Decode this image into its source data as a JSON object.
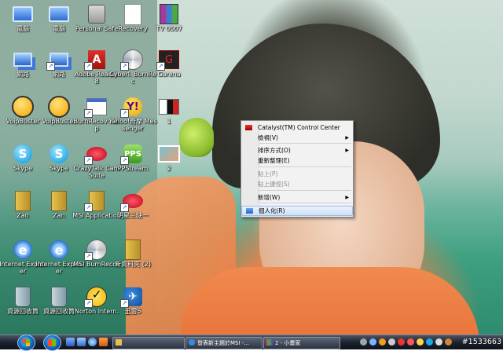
{
  "desktop": {
    "icons": [
      {
        "id": "pc1",
        "label": "電腦",
        "glyph": "computer-icon",
        "shortcut": false
      },
      {
        "id": "pc2",
        "label": "電腦",
        "glyph": "computer-icon",
        "shortcut": false
      },
      {
        "id": "lock",
        "label": "Personal Safe",
        "glyph": "lock-icon",
        "shortcut": false
      },
      {
        "id": "recovery",
        "label": "Recovery",
        "glyph": "document-icon",
        "shortcut": false
      },
      {
        "id": "tv",
        "label": "TV 0507",
        "glyph": "rar-archive-icon",
        "shortcut": false
      },
      {
        "id": "net1",
        "label": "網路",
        "glyph": "network-icon",
        "shortcut": false
      },
      {
        "id": "net2",
        "label": "網路",
        "glyph": "network-icon",
        "shortcut": true
      },
      {
        "id": "adobe",
        "label": "Adobe Reader 8",
        "glyph": "adobe-reader-icon",
        "shortcut": true
      },
      {
        "id": "cyberlink",
        "label": "Cyberl. BurnRec",
        "glyph": "disc-icon",
        "shortcut": true
      },
      {
        "id": "garena",
        "label": "Garena",
        "glyph": "garena-icon",
        "shortcut": true
      },
      {
        "id": "voip1",
        "label": "VoipBuster",
        "glyph": "voipbuster-icon",
        "shortcut": false
      },
      {
        "id": "voip2",
        "label": "VoipBuster",
        "glyph": "voipbuster-icon",
        "shortcut": false
      },
      {
        "id": "burnhelp",
        "label": "BurnRecov Help",
        "glyph": "window-icon",
        "shortcut": true
      },
      {
        "id": "yahoo",
        "label": "Yahoo!奇摩 Messenger",
        "glyph": "yahoo-messenger-icon",
        "shortcut": true
      },
      {
        "id": "img1",
        "label": "1",
        "glyph": "image-icon",
        "shortcut": false
      },
      {
        "id": "skype1",
        "label": "Skype",
        "glyph": "skype-icon",
        "shortcut": false
      },
      {
        "id": "skype2",
        "label": "Skype",
        "glyph": "skype-icon",
        "shortcut": false
      },
      {
        "id": "crazy",
        "label": "CrazyTalk Cam Suite",
        "glyph": "lips-icon",
        "shortcut": true
      },
      {
        "id": "pps",
        "label": "PPStream",
        "glyph": "pps-icon",
        "shortcut": true
      },
      {
        "id": "img2",
        "label": "2",
        "glyph": "photo-icon",
        "shortcut": false
      },
      {
        "id": "zan1",
        "label": "Zan",
        "glyph": "folder-zip-icon",
        "shortcut": false
      },
      {
        "id": "zan2",
        "label": "Zan",
        "glyph": "folder-zip-icon",
        "shortcut": false
      },
      {
        "id": "msi",
        "label": "MSI Application",
        "glyph": "folder-zip-icon",
        "shortcut": true
      },
      {
        "id": "game",
        "label": "明星三缺一",
        "glyph": "game-icon",
        "shortcut": true
      },
      {
        "id": "ie1",
        "label": "Internet Explorer",
        "glyph": "internet-explorer-icon",
        "shortcut": false
      },
      {
        "id": "ie2",
        "label": "Internet Explorer",
        "glyph": "internet-explorer-icon",
        "shortcut": false
      },
      {
        "id": "msiburn",
        "label": "MSI BurnRecov",
        "glyph": "disc-icon",
        "shortcut": true
      },
      {
        "id": "newzip",
        "label": "新資料夾 (2)",
        "glyph": "folder-zip-icon",
        "shortcut": false
      },
      {
        "id": "bin1",
        "label": "資源回收筒",
        "glyph": "recycle-bin-icon",
        "shortcut": false
      },
      {
        "id": "bin2",
        "label": "資源回收筒",
        "glyph": "recycle-bin-icon",
        "shortcut": false
      },
      {
        "id": "norton",
        "label": "Norton Intern.",
        "glyph": "norton-icon",
        "shortcut": true
      },
      {
        "id": "cn",
        "label": "迅雷5",
        "glyph": "thunder-icon",
        "shortcut": true
      }
    ]
  },
  "context_menu": {
    "items": [
      {
        "label": "Catalyst(TM) Control Center",
        "icon": "catalyst-icon",
        "disabled": false,
        "submenu": false,
        "highlighted": false
      },
      {
        "label": "檢視(V)",
        "disabled": false,
        "submenu": true,
        "highlighted": false
      },
      {
        "label": "排序方式(O)",
        "disabled": false,
        "submenu": true,
        "highlighted": false
      },
      {
        "label": "重新整理(E)",
        "disabled": false,
        "submenu": false,
        "highlighted": false
      },
      {
        "label": "貼上(P)",
        "disabled": true,
        "submenu": false,
        "highlighted": false
      },
      {
        "label": "貼上捷徑(S)",
        "disabled": true,
        "submenu": false,
        "highlighted": false
      },
      {
        "label": "新增(W)",
        "disabled": false,
        "submenu": true,
        "highlighted": false
      },
      {
        "label": "個人化(R)",
        "icon": "personalize-icon",
        "disabled": false,
        "submenu": false,
        "highlighted": true
      }
    ]
  },
  "taskbar": {
    "buttons": [
      {
        "label": "",
        "icon": "folder-icon"
      },
      {
        "label": "發表新主題於MSI -...",
        "icon": "internet-explorer-icon"
      },
      {
        "label": "2 - 小畫家",
        "icon": "paint-icon"
      }
    ],
    "tray_text": "#1533663"
  }
}
